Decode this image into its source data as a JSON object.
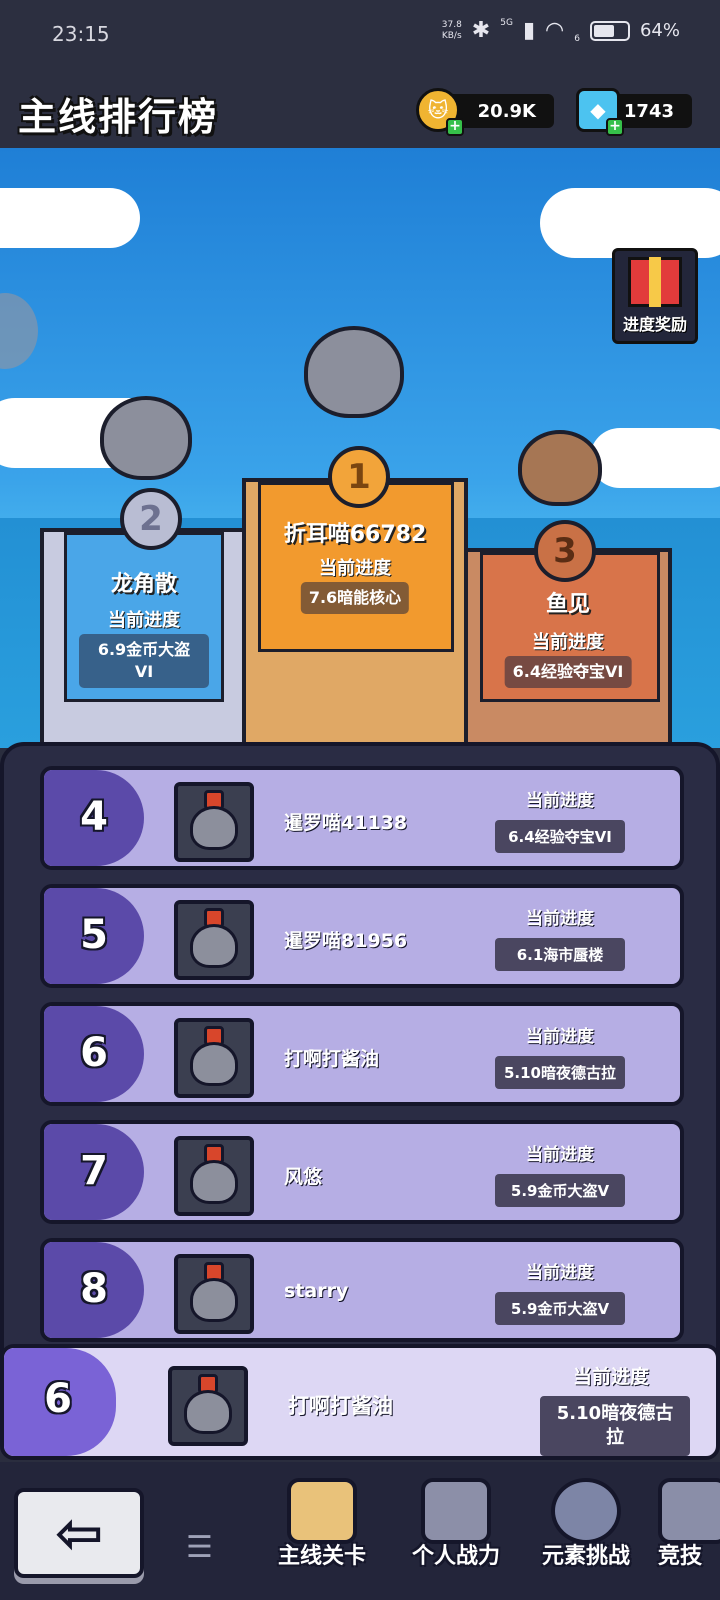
{
  "status_bar": {
    "time": "23:15",
    "net_speed_value": "37.8",
    "net_speed_unit": "KB/s",
    "signal_label": "5G",
    "wifi_sub": "6",
    "battery_percent": "64%",
    "battery_level": 0.64
  },
  "header": {
    "title": "主线排行榜",
    "coins": "20.9K",
    "gems": "1743"
  },
  "scene": {
    "gift_label": "进度奖励"
  },
  "podium": {
    "progress_label": "当前进度",
    "first": {
      "rank": "1",
      "name": "折耳喵66782",
      "progress": "7.6暗能核心"
    },
    "second": {
      "rank": "2",
      "name": "龙角散",
      "progress": "6.9金币大盗\nVI"
    },
    "third": {
      "rank": "3",
      "name": "鱼见",
      "progress": "6.4经验夺宝VI"
    }
  },
  "ranking": {
    "progress_label": "当前进度",
    "rows": [
      {
        "rank": "4",
        "name": "暹罗喵41138",
        "progress": "6.4经验夺宝VI"
      },
      {
        "rank": "5",
        "name": "暹罗喵81956",
        "progress": "6.1海市蜃楼"
      },
      {
        "rank": "6",
        "name": "打啊打酱油",
        "progress": "5.10暗夜德古拉"
      },
      {
        "rank": "7",
        "name": "风悠",
        "progress": "5.9金币大盗V"
      },
      {
        "rank": "8",
        "name": "starry",
        "progress": "5.9金币大盗V"
      }
    ]
  },
  "my_rank": {
    "rank": "6",
    "name": "打啊打酱油",
    "progress_label": "当前进度",
    "progress": "5.10暗夜德古\n拉"
  },
  "bottom_nav": {
    "back_glyph": "⇦",
    "menu_glyph": "☰",
    "tabs": [
      {
        "label": "主线关卡",
        "icon": "scroll-flag-icon"
      },
      {
        "label": "个人战力",
        "icon": "paw-badge-icon"
      },
      {
        "label": "元素挑战",
        "icon": "element-orb-icon"
      },
      {
        "label": "竞技",
        "icon": "colosseum-icon"
      }
    ]
  },
  "colors": {
    "panel": "#2a2c44",
    "row": "#b6aee4",
    "rank_tab": "#5b4aa9",
    "first_place": "#f29a2e",
    "second_place": "#4aa6e8",
    "third_place": "#d8744a"
  }
}
